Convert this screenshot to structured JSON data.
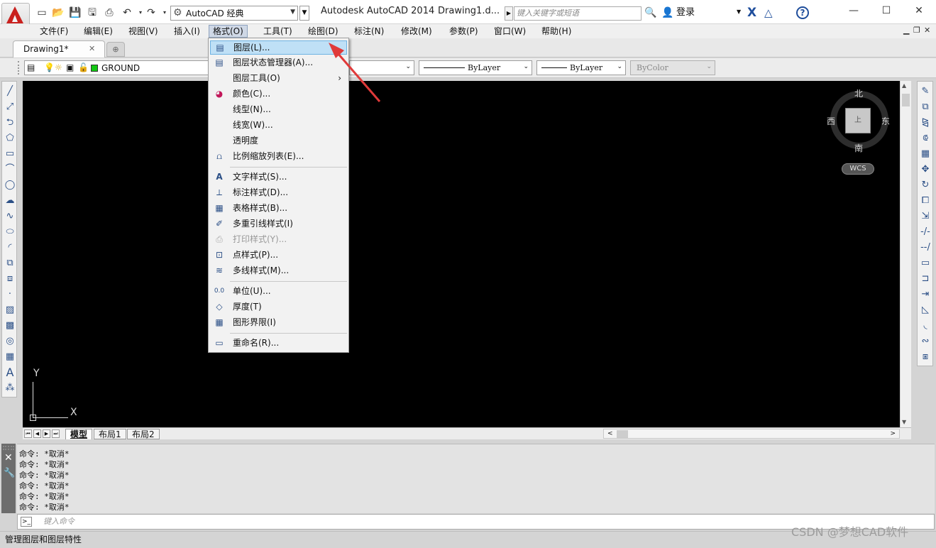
{
  "window": {
    "app_title": "Autodesk AutoCAD 2014",
    "doc_title": "Drawing1.d...",
    "workspace": "AutoCAD 经典",
    "search_placeholder": "键入关键字或短语",
    "login": "登录"
  },
  "menubar": [
    "文件(F)",
    "编辑(E)",
    "视图(V)",
    "插入(I)",
    "格式(O)",
    "工具(T)",
    "绘图(D)",
    "标注(N)",
    "修改(M)",
    "参数(P)",
    "窗口(W)",
    "帮助(H)"
  ],
  "active_menu": "格式(O)",
  "tabs": {
    "active": "Drawing1*"
  },
  "layer_bar": {
    "layer": "GROUND",
    "layer_color": "#14c814",
    "linetype": "ByLayer",
    "lineweight": "ByLayer",
    "plotstyle": "ByColor"
  },
  "format_menu": {
    "items": [
      {
        "label": "图层(L)...",
        "icon": "layer-icon",
        "highlight": true
      },
      {
        "label": "图层状态管理器(A)...",
        "icon": "layer-state-icon"
      },
      {
        "label": "图层工具(O)",
        "icon": "",
        "submenu": true
      },
      {
        "label": "颜色(C)...",
        "icon": "color-wheel-icon"
      },
      {
        "label": "线型(N)...",
        "icon": ""
      },
      {
        "label": "线宽(W)...",
        "icon": ""
      },
      {
        "label": "透明度",
        "icon": ""
      },
      {
        "label": "比例缩放列表(E)...",
        "icon": "scale-list-icon"
      },
      {
        "label": "文字样式(S)...",
        "icon": "text-style-icon"
      },
      {
        "label": "标注样式(D)...",
        "icon": "dim-style-icon"
      },
      {
        "label": "表格样式(B)...",
        "icon": "table-style-icon"
      },
      {
        "label": "多重引线样式(I)",
        "icon": "mleader-style-icon"
      },
      {
        "label": "打印样式(Y)...",
        "icon": "plot-style-icon",
        "disabled": true
      },
      {
        "label": "点样式(P)...",
        "icon": "point-style-icon"
      },
      {
        "label": "多线样式(M)...",
        "icon": "mline-style-icon"
      },
      {
        "label": "单位(U)...",
        "icon": "units-icon"
      },
      {
        "label": "厚度(T)",
        "icon": "thickness-icon"
      },
      {
        "label": "图形界限(I)",
        "icon": "limits-icon"
      },
      {
        "label": "重命名(R)...",
        "icon": "rename-icon"
      }
    ]
  },
  "viewcube": {
    "north": "北",
    "south": "南",
    "east": "东",
    "west": "西",
    "face": "上",
    "wcs": "WCS"
  },
  "ucs": {
    "x": "X",
    "y": "Y"
  },
  "layout_tabs": [
    "模型",
    "布局1",
    "布局2"
  ],
  "command": {
    "history": [
      "命令: *取消*",
      "命令: *取消*",
      "命令: *取消*",
      "命令: *取消*",
      "命令: *取消*",
      "命令: *取消*"
    ],
    "input_placeholder": "键入命令"
  },
  "status_text": "管理图层和图层特性",
  "watermark": "CSDN @梦想CAD软件"
}
